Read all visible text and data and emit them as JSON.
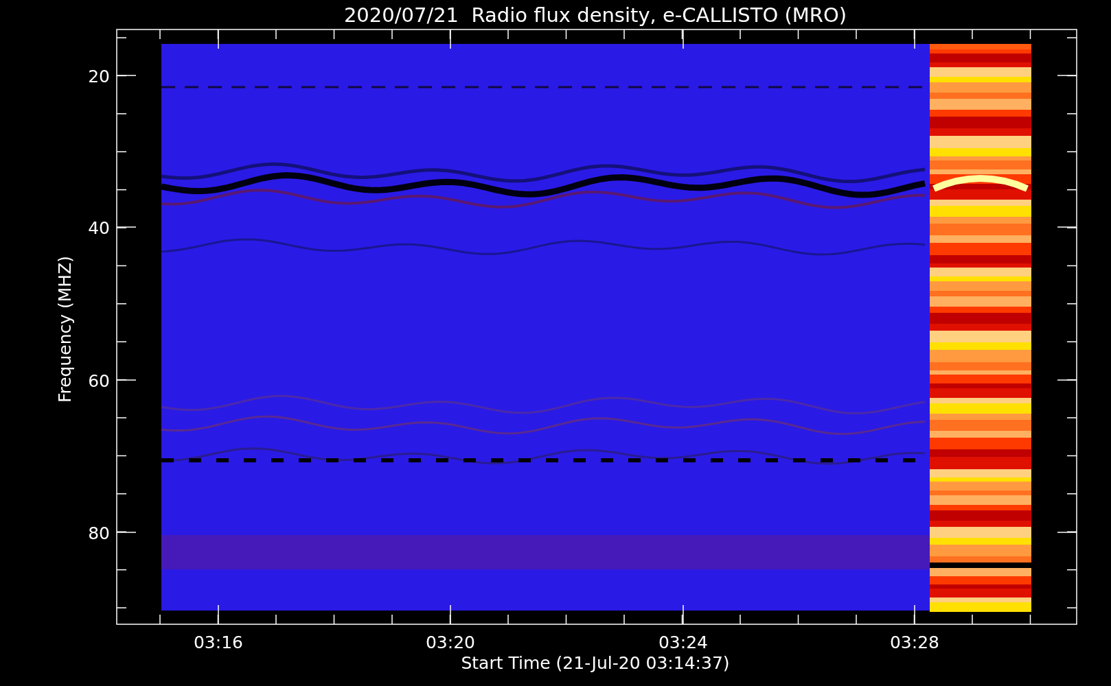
{
  "title": "2020/07/21  Radio flux density, e-CALLISTO (MRO)",
  "y_axis": {
    "label": "Frequency (MHZ)",
    "ticks": [
      "20",
      "40",
      "60",
      "80"
    ]
  },
  "x_axis": {
    "label": "Start Time (21-Jul-20 03:14:37)",
    "ticks": [
      "03:16",
      "03:20",
      "03:24",
      "03:28"
    ]
  }
}
